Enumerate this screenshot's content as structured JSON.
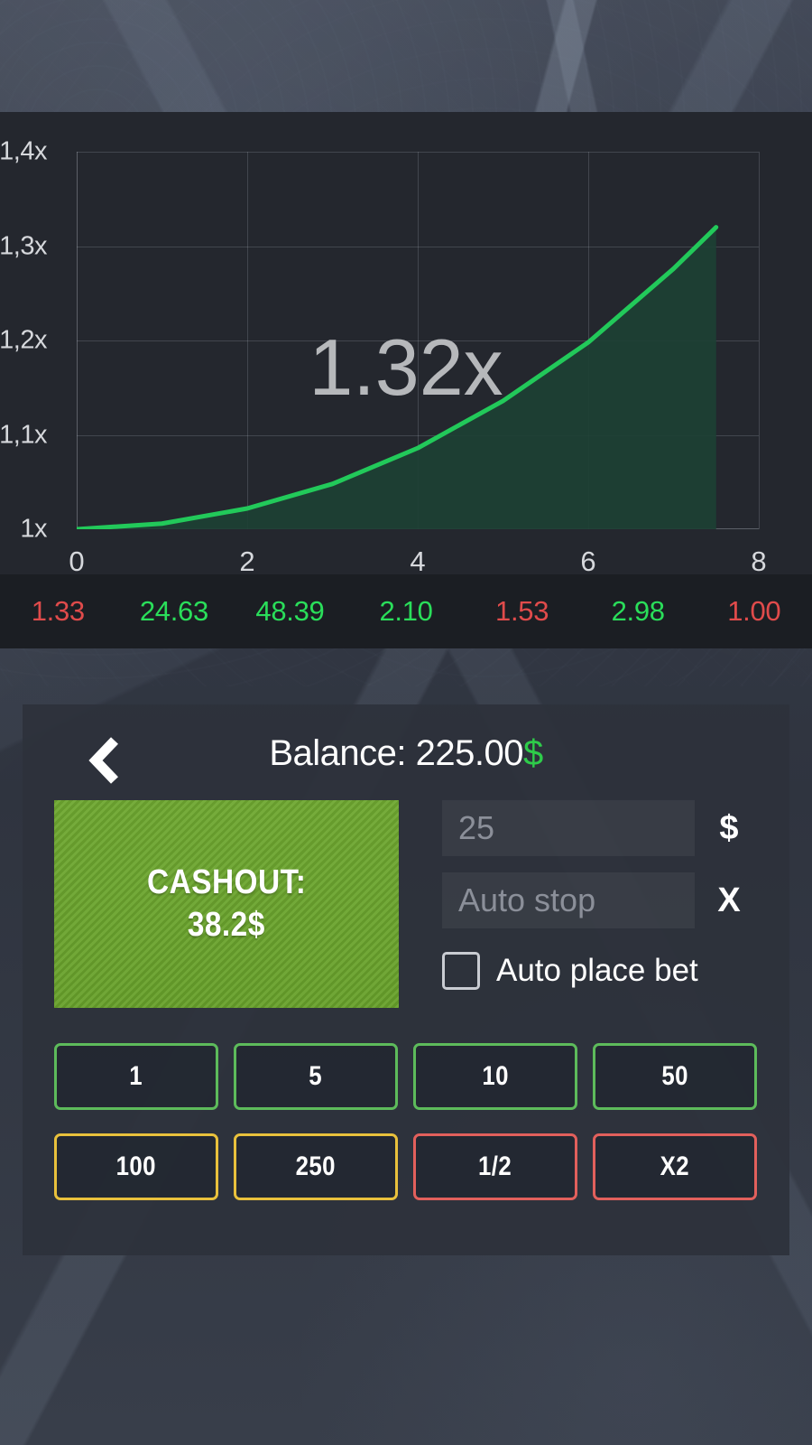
{
  "chart_data": {
    "type": "line",
    "title": "",
    "xlabel": "",
    "ylabel": "",
    "x": [
      0,
      1,
      2,
      3,
      4,
      5,
      6,
      7,
      7.5
    ],
    "y": [
      1.0,
      1.006,
      1.022,
      1.048,
      1.086,
      1.136,
      1.198,
      1.276,
      1.32
    ],
    "xlim": [
      0,
      8
    ],
    "ylim": [
      1.0,
      1.4
    ],
    "xticks": [
      "0",
      "2",
      "4",
      "6",
      "8"
    ],
    "yticks": [
      "1x",
      "1,1x",
      "1,2x",
      "1,3x",
      "1,4x"
    ],
    "ytick_values": [
      1.0,
      1.1,
      1.2,
      1.3,
      1.4
    ],
    "xtick_values": [
      0,
      2,
      4,
      6,
      8
    ],
    "grid": true,
    "legend": "none",
    "line_color": "#22c95a",
    "fill_color": "#1d4034",
    "current_value_label": "1.32x",
    "current_value": 1.32
  },
  "chart": {
    "multiplier": "1.32x"
  },
  "history": {
    "items": [
      {
        "value": "1.33",
        "color": "#e04b4b"
      },
      {
        "value": "24.63",
        "color": "#2ade5a"
      },
      {
        "value": "48.39",
        "color": "#2ade5a"
      },
      {
        "value": "2.10",
        "color": "#2ade5a"
      },
      {
        "value": "1.53",
        "color": "#e04b4b"
      },
      {
        "value": "2.98",
        "color": "#2ade5a"
      },
      {
        "value": "1.00",
        "color": "#e04b4b"
      }
    ]
  },
  "panel": {
    "back_icon": "chevron-left-icon",
    "balance_label": "Balance: 225.00",
    "balance_currency": "$",
    "cashout": {
      "line1": "CASHOUT:",
      "line2": "38.2$"
    },
    "bet_amount_field": {
      "value": "25",
      "placeholder": "25",
      "suffix": "$"
    },
    "auto_stop_field": {
      "value": "",
      "placeholder": "Auto stop",
      "suffix": "X"
    },
    "auto_place_bet": {
      "label": "Auto place bet",
      "checked": false
    },
    "bet_buttons": [
      {
        "label": "1",
        "style": "green"
      },
      {
        "label": "5",
        "style": "green"
      },
      {
        "label": "10",
        "style": "green"
      },
      {
        "label": "50",
        "style": "green"
      },
      {
        "label": "100",
        "style": "yellow"
      },
      {
        "label": "250",
        "style": "yellow"
      },
      {
        "label": "1/2",
        "style": "red"
      },
      {
        "label": "X2",
        "style": "red"
      }
    ]
  },
  "colors": {
    "green": "#5dbb5b",
    "yellow": "#e9c13c",
    "red": "#e2605c",
    "cashout_bg": "#6aa52e",
    "line": "#22c95a"
  }
}
